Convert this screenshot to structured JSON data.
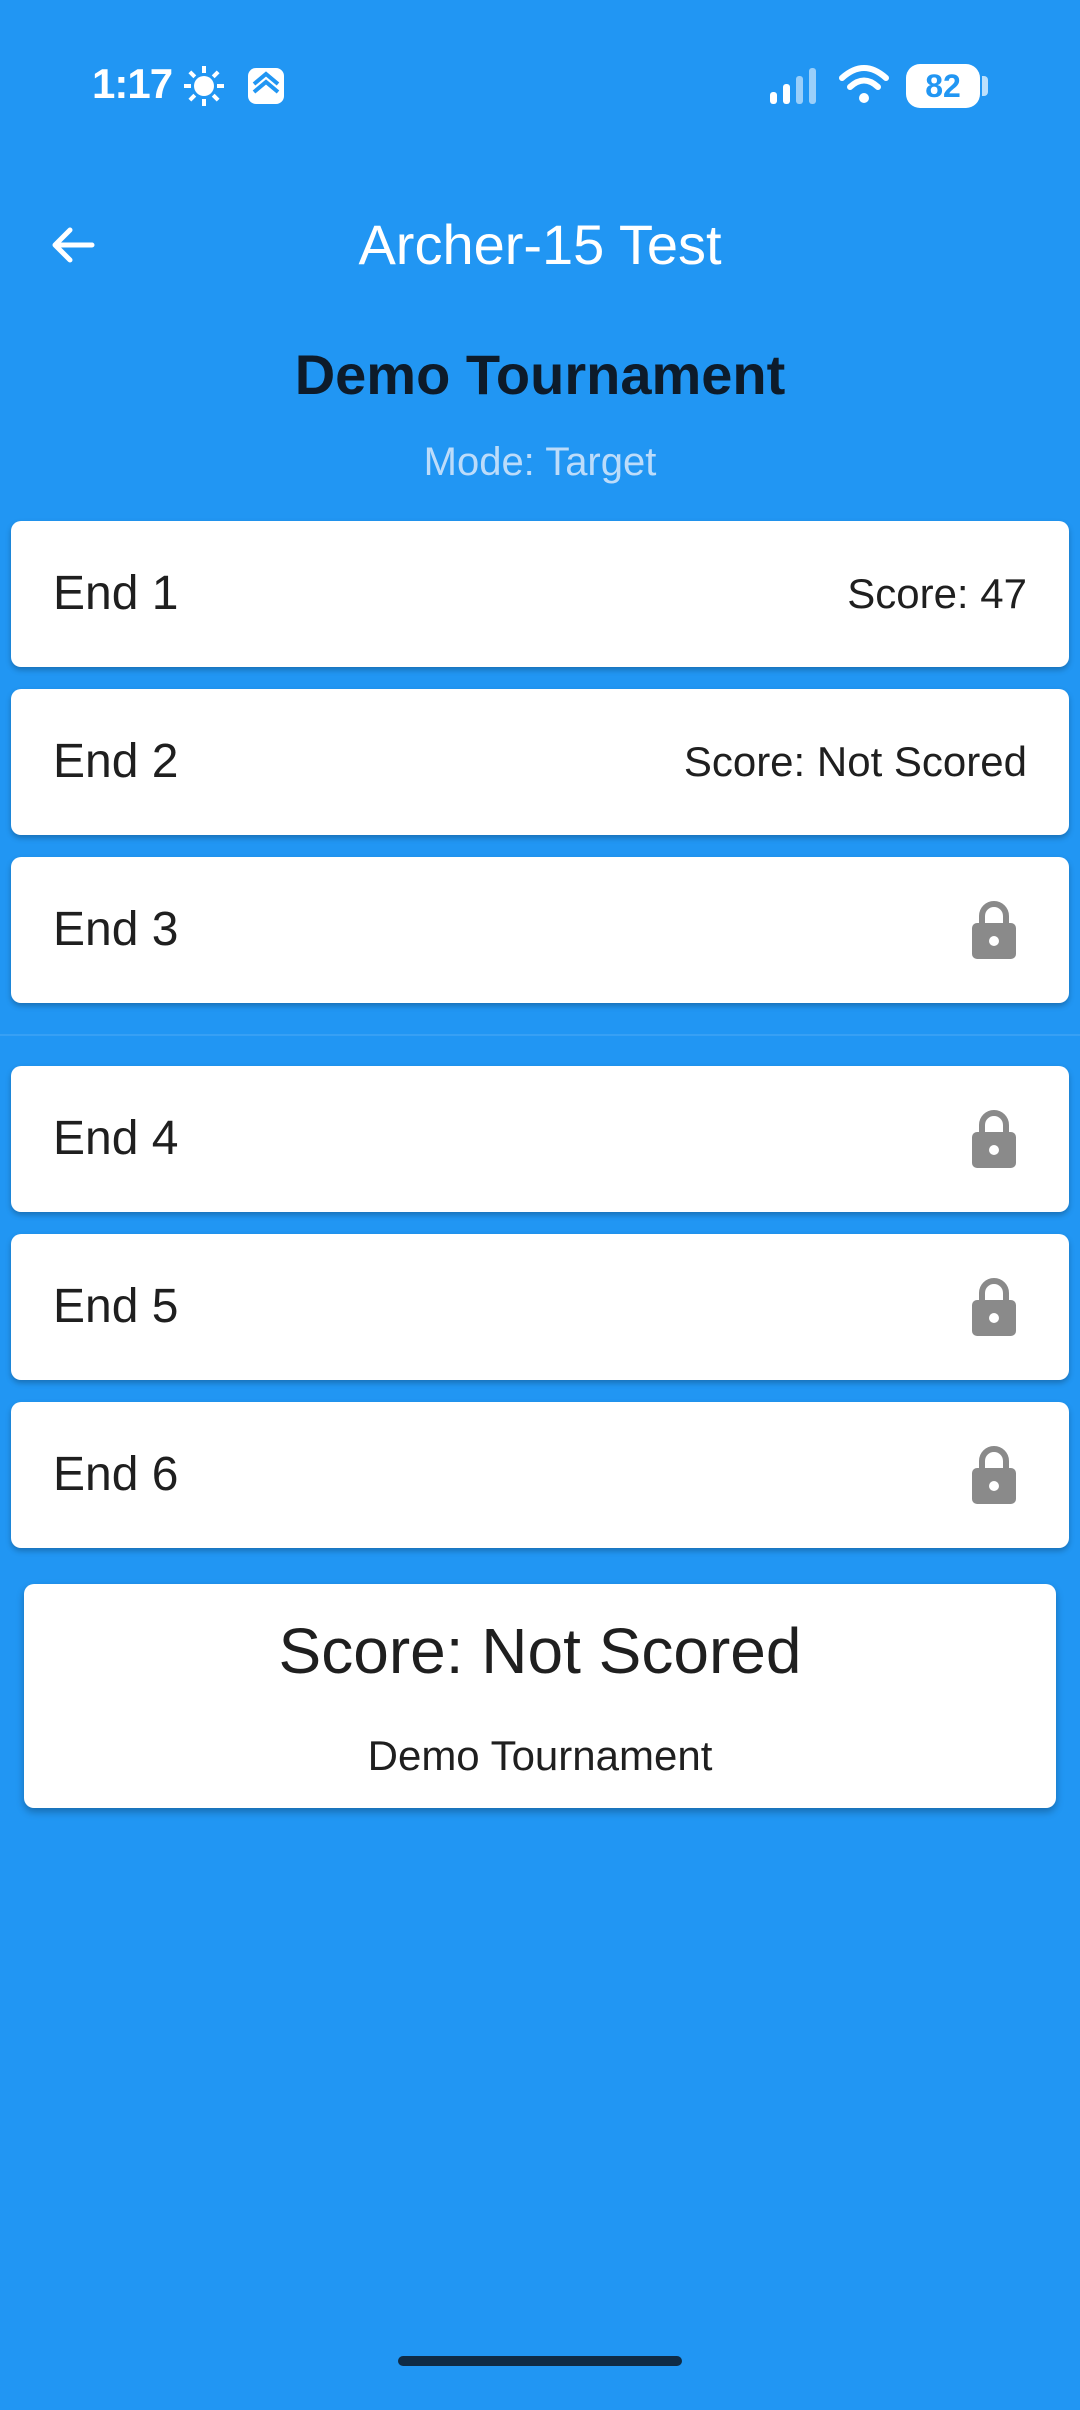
{
  "status_bar": {
    "time": "1:17",
    "battery_level": "82",
    "icons": [
      "brightness-icon",
      "app-notification-icon",
      "signal-icon",
      "wifi-icon",
      "battery-icon"
    ]
  },
  "app_bar": {
    "title": "Archer-15 Test",
    "back_icon": "arrow-back-icon"
  },
  "tournament": {
    "name": "Demo Tournament",
    "mode": "Mode: Target"
  },
  "ends": [
    {
      "label": "End 1",
      "score": "Score: 47",
      "locked": false
    },
    {
      "label": "End 2",
      "score": "Score: Not Scored",
      "locked": false
    },
    {
      "label": "End 3",
      "locked": true,
      "icon": "lock-icon"
    },
    {
      "label": "End 4",
      "locked": true,
      "icon": "lock-icon"
    },
    {
      "label": "End 5",
      "locked": true,
      "icon": "lock-icon"
    },
    {
      "label": "End 6",
      "locked": true,
      "icon": "lock-icon"
    }
  ],
  "summary": {
    "score": "Score: Not Scored",
    "tournament": "Demo Tournament"
  },
  "colors": {
    "background": "#2196F3",
    "card": "#FFFFFF",
    "lock": "#8A8A8A",
    "title_dark": "#0D1B2A",
    "mode_text": "#BCDCFA"
  }
}
